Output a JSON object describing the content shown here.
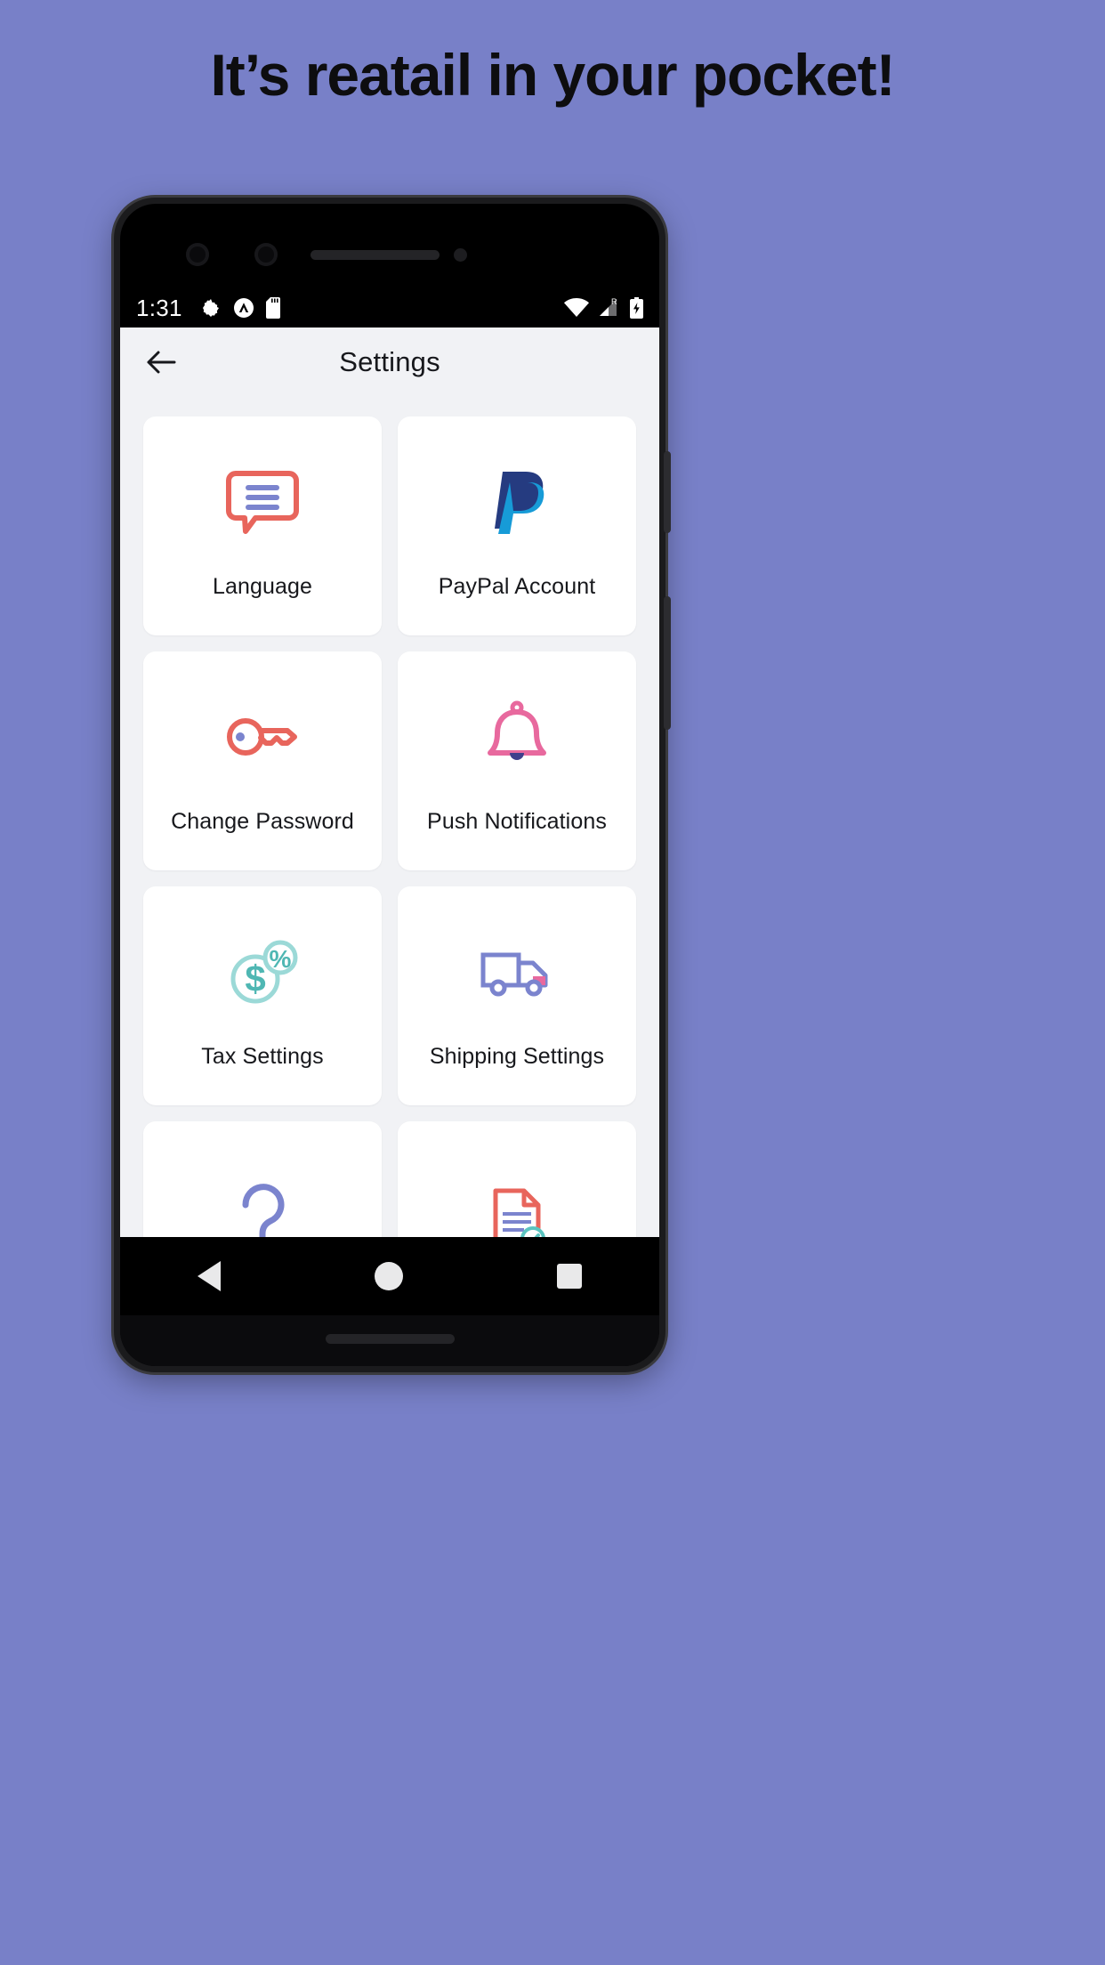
{
  "poster": {
    "headline": "It’s reatail in your pocket!",
    "background_color": "#7880c8"
  },
  "statusbar": {
    "time": "1:31",
    "left_icons": [
      "gear-icon",
      "expo-icon",
      "sd-card-icon"
    ],
    "right_icons": [
      "wifi-icon",
      "cell-signal-roaming-icon",
      "battery-charging-icon"
    ],
    "roaming_label": "R"
  },
  "appbar": {
    "back_label": "back-arrow",
    "title": "Settings"
  },
  "grid": {
    "cards": [
      {
        "label": "Language",
        "icon": "speech-bubble-icon"
      },
      {
        "label": "PayPal Account",
        "icon": "paypal-icon"
      },
      {
        "label": "Change Password",
        "icon": "key-icon"
      },
      {
        "label": "Push Notifications",
        "icon": "bell-icon"
      },
      {
        "label": "Tax Settings",
        "icon": "dollar-percent-icon"
      },
      {
        "label": "Shipping Settings",
        "icon": "truck-icon"
      },
      {
        "label": "",
        "icon": "question-mark-icon"
      },
      {
        "label": "",
        "icon": "document-check-icon"
      }
    ]
  },
  "navbar": {
    "items": [
      "nav-back-icon",
      "nav-home-icon",
      "nav-recents-icon"
    ]
  },
  "colors": {
    "coral": "#e8655c",
    "periwinkle": "#7b84ce",
    "pink": "#e8699e",
    "teal": "#5bc4c0",
    "teal_light": "#9bd9d7",
    "paypal_dark": "#253b80",
    "paypal_light": "#179bd7",
    "card_bg": "#ffffff",
    "screen_bg": "#f1f2f5",
    "text": "#17181c"
  }
}
